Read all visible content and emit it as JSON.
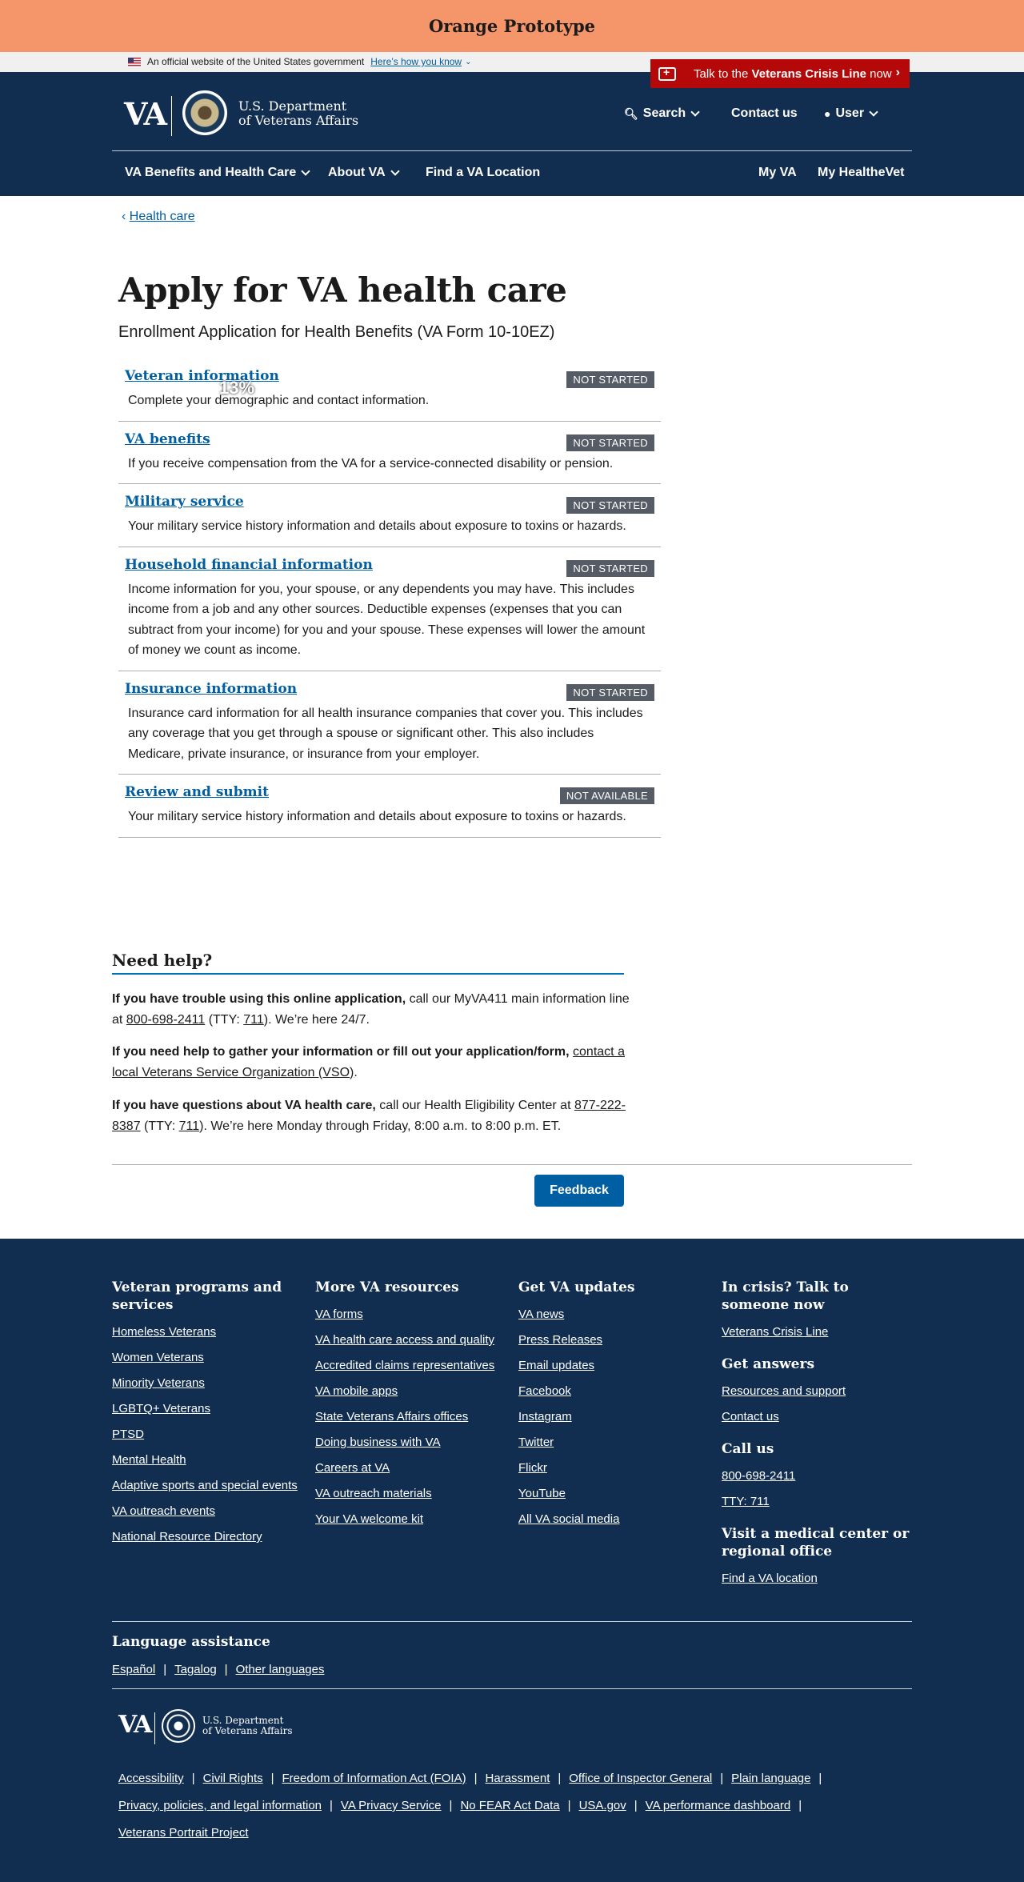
{
  "prototype_bar": {
    "title": "Orange Prototype"
  },
  "official_banner": {
    "text": "An official website of the United States government",
    "link": "Here’s how you know"
  },
  "header": {
    "crisis_prefix": "Talk to the ",
    "crisis_bold": "Veterans Crisis Line",
    "crisis_suffix": " now",
    "logo": "VA",
    "dept_line1": "U.S. Department",
    "dept_line2": "of Veterans Affairs",
    "search": "Search",
    "contact": "Contact us",
    "user": "User"
  },
  "nav": {
    "benefits": "VA Benefits and Health Care",
    "about": "About VA",
    "find": "Find a VA Location",
    "my_va": "My VA",
    "healthevet": "My HealtheVet"
  },
  "breadcrumb": {
    "arrow": "‹",
    "label": "Health care"
  },
  "page": {
    "title": "Apply for VA health care",
    "subtitle": "Enrollment Application for Health Benefits (VA Form 10-10EZ)",
    "progress": 0.13,
    "progress_label": "13%"
  },
  "sections": [
    {
      "title": "Veteran information",
      "status": "NOT STARTED",
      "desc": "Complete your demographic and contact information."
    },
    {
      "title": "VA benefits",
      "status": "NOT STARTED",
      "desc": "If you receive compensation from the VA for a service-connected disability or pension."
    },
    {
      "title": "Military service",
      "status": "NOT STARTED",
      "desc": "Your military service history information and details about exposure to toxins or hazards."
    },
    {
      "title": "Household financial information",
      "status": "NOT STARTED",
      "desc": "Income information for you, your spouse, or any dependents you may have. This includes income from a job and any other sources. Deductible expenses (expenses that you can subtract from your income) for you and your spouse. These expenses will lower the amount of money we count as income."
    },
    {
      "title": "Insurance information",
      "status": "NOT STARTED",
      "desc": "Insurance card information for all health insurance companies that cover you. This includes any coverage that you get through a spouse or significant other. This also includes Medicare, private insurance, or insurance from your employer."
    },
    {
      "title": "Review and submit",
      "status": "NOT AVAILABLE",
      "desc": "Your military service history information and details about exposure to toxins or hazards."
    }
  ],
  "help": {
    "title": "Need help?",
    "p1_bold": "If you have trouble using this online application,",
    "p1_text1": " call our MyVA411 main information line at ",
    "p1_phone": "800-698-2411",
    "p1_text2": " (TTY: ",
    "p1_tty": "711",
    "p1_text3": "). We’re here 24/7.",
    "p2_bold": "If you need help to gather your information or fill out your application/form,",
    "p2_text1": " ",
    "p2_link": "contact a local Veterans Service Organization (VSO)",
    "p2_text2": ".",
    "p3_bold": "If you have questions about VA health care,",
    "p3_text1": " call our Health Eligibility Center at ",
    "p3_phone": "877-222-8387",
    "p3_text2": " (TTY: ",
    "p3_tty": "711",
    "p3_text3": "). We’re here Monday through Friday, 8:00 a.m. to 8:00 p.m. ET.",
    "feedback": "Feedback"
  },
  "footer": {
    "col1": {
      "title": "Veteran programs and services",
      "links": [
        "Homeless Veterans",
        "Women Veterans",
        "Minority Veterans",
        "LGBTQ+ Veterans",
        "PTSD",
        "Mental Health",
        "Adaptive sports and special events",
        "VA outreach events",
        "National Resource Directory"
      ]
    },
    "col2": {
      "title": "More VA resources",
      "links": [
        "VA forms",
        "VA health care access and quality",
        "Accredited claims representatives",
        "VA mobile apps",
        "State Veterans Affairs offices",
        "Doing business with VA",
        "Careers at VA",
        "VA outreach materials",
        "Your VA welcome kit"
      ]
    },
    "col3": {
      "title": "Get VA updates",
      "links": [
        "VA news",
        "Press Releases",
        "Email updates",
        "Facebook",
        "Instagram",
        "Twitter",
        "Flickr",
        "YouTube",
        "All VA social media"
      ]
    },
    "col4": {
      "crisis_title": "In crisis? Talk to someone now",
      "crisis_link": "Veterans Crisis Line",
      "answers_title": "Get answers",
      "answers_links": [
        "Resources and support",
        "Contact us"
      ],
      "call_title": "Call us",
      "call_links": [
        "800-698-2411",
        "TTY: 711"
      ],
      "visit_title": "Visit a medical center or regional office",
      "visit_link": "Find a VA location"
    },
    "language": {
      "title": "Language assistance",
      "links": [
        "Español",
        "Tagalog",
        "Other languages"
      ]
    },
    "logo": "VA",
    "dept_line1": "U.S. Department",
    "dept_line2": "of Veterans Affairs",
    "bottom_row1": [
      "Accessibility",
      "Civil Rights",
      "Freedom of Information Act (FOIA)",
      "Harassment",
      "Office of Inspector General",
      "Plain language"
    ],
    "bottom_row2": [
      "Privacy, policies, and legal information",
      "VA Privacy Service",
      "No FEAR Act Data",
      "USA.gov",
      "VA performance dashboard"
    ],
    "bottom_row3": [
      "Veterans Portrait Project"
    ]
  },
  "colors": {
    "prototype": "#f5956a",
    "header": "#112e51",
    "crisis": "#b50909",
    "link": "#005ea2",
    "badge": "#565c65",
    "feedback": "#005ea2"
  }
}
